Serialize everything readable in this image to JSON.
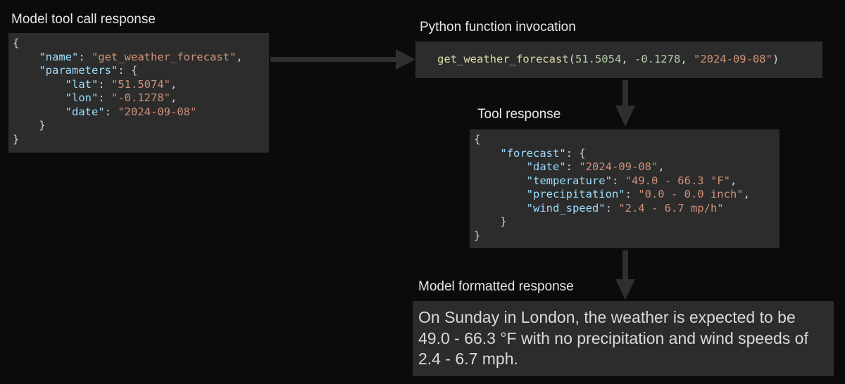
{
  "labels": {
    "tool_call": "Model tool call response",
    "python_invocation": "Python function invocation",
    "tool_response": "Tool response",
    "formatted_response": "Model formatted response"
  },
  "tool_call": {
    "open_brace": "{",
    "name_key": "\"name\"",
    "name_value": "\"get_weather_forecast\"",
    "parameters_key": "\"parameters\"",
    "lat_key": "\"lat\"",
    "lat_value": "\"51.5074\"",
    "lon_key": "\"lon\"",
    "lon_value": "\"-0.1278\"",
    "date_key": "\"date\"",
    "date_value": "\"2024-09-08\"",
    "inner_close": "}",
    "close_brace": "}"
  },
  "invocation": {
    "function": "get_weather_forecast",
    "arg_lat": "51.5054",
    "arg_lon": "-0.1278",
    "arg_date": "\"2024-09-08\""
  },
  "tool_response": {
    "open_brace": "{",
    "forecast_key": "\"forecast\"",
    "date_key": "\"date\"",
    "date_value": "\"2024-09-08\"",
    "temperature_key": "\"temperature\"",
    "temperature_value": "\"49.0 - 66.3 °F\"",
    "precipitation_key": "\"precipitation\"",
    "precipitation_value": "\"0.0 - 0.0 inch\"",
    "wind_speed_key": "\"wind_speed\"",
    "wind_speed_value": "\"2.4 - 6.7 mp/h\"",
    "inner_close": "}",
    "close_brace": "}"
  },
  "formatted_response": {
    "text": "On Sunday in London, the weather is expected to be 49.0 - 66.3 °F with no precipitation and wind speeds of 2.4 - 6.7 mph."
  },
  "colors": {
    "background": "#0b0b0b",
    "box": "#2c2c2c",
    "key": "#9cdcfe",
    "string": "#ce9178",
    "number": "#b5cea8",
    "function": "#dcdcaa",
    "arrow": "#2f2f2f"
  }
}
